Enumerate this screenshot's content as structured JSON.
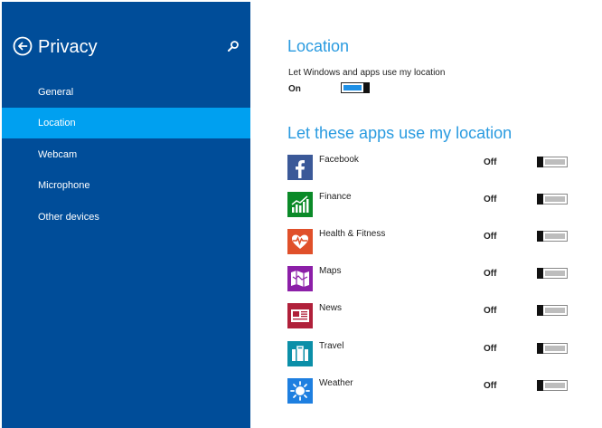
{
  "sidebar": {
    "title": "Privacy",
    "items": [
      {
        "label": "General",
        "selected": false
      },
      {
        "label": "Location",
        "selected": true
      },
      {
        "label": "Webcam",
        "selected": false
      },
      {
        "label": "Microphone",
        "selected": false
      },
      {
        "label": "Other devices",
        "selected": false
      }
    ],
    "colors": {
      "background": "#004d99",
      "selected": "#00a0f0"
    }
  },
  "main": {
    "location_title": "Location",
    "location_setting_label": "Let Windows and apps use my location",
    "location_state": "On",
    "apps_title": "Let these apps use my location",
    "apps": [
      {
        "name": "Facebook",
        "state": "Off",
        "icon": "facebook-icon",
        "color": "#3b5998"
      },
      {
        "name": "Finance",
        "state": "Off",
        "icon": "finance-chart-icon",
        "color": "#0a8a28"
      },
      {
        "name": "Health & Fitness",
        "state": "Off",
        "icon": "heart-pulse-icon",
        "color": "#e0502a"
      },
      {
        "name": "Maps",
        "state": "Off",
        "icon": "map-icon",
        "color": "#8c1fa8"
      },
      {
        "name": "News",
        "state": "Off",
        "icon": "newspaper-icon",
        "color": "#b0203a"
      },
      {
        "name": "Travel",
        "state": "Off",
        "icon": "suitcase-icon",
        "color": "#0b8fa8"
      },
      {
        "name": "Weather",
        "state": "Off",
        "icon": "sun-icon",
        "color": "#1e7fe0"
      }
    ]
  }
}
